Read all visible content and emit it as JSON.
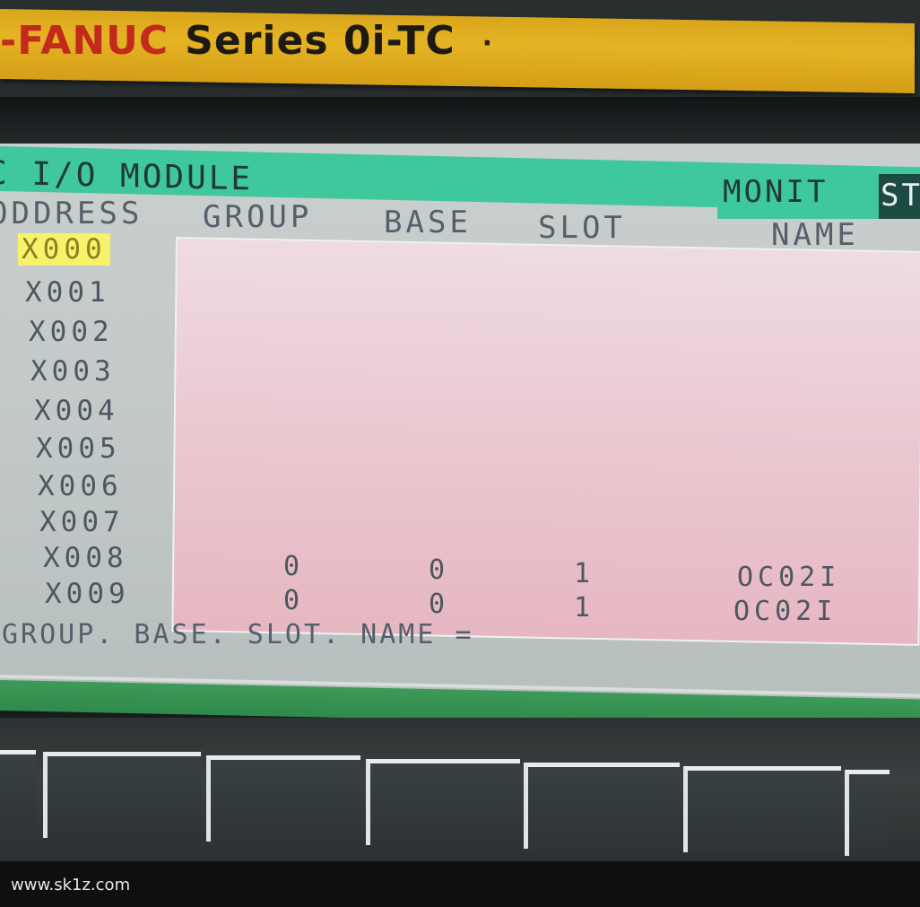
{
  "brand": {
    "maker": "-FANUC",
    "series": "Series 0i-TC",
    "dot": "·"
  },
  "screen": {
    "title": "C I/O MODULE",
    "mode": "MONIT",
    "mode_suffix": "ST",
    "columns": {
      "address": "ODDRESS",
      "group": "GROUP",
      "base": "BASE",
      "slot": "SLOT",
      "name": "NAME"
    },
    "addresses": [
      "X000",
      "X001",
      "X002",
      "X003",
      "X004",
      "X005",
      "X006",
      "X007",
      "X008",
      "X009"
    ],
    "selected_address": "X000",
    "rows": [
      {
        "address": "X008",
        "group": "0",
        "base": "0",
        "slot": "1",
        "name": "OC02I"
      },
      {
        "address": "X009",
        "group": "0",
        "base": "0",
        "slot": "1",
        "name": "OC02I"
      }
    ],
    "prompt": "GROUP. BASE. SLOT. NAME ="
  },
  "softkeys": [
    "",
    "",
    "",
    "",
    "",
    ""
  ],
  "watermark": "www.sk1z.com",
  "colors": {
    "brand_bar": "#e5b424",
    "fanuc_red": "#c22a1c",
    "title_bar": "#3fc79d",
    "data_panel": "#eac6cf",
    "selected_highlight": "#f6f26a",
    "status_strip": "#2f8a4b"
  }
}
